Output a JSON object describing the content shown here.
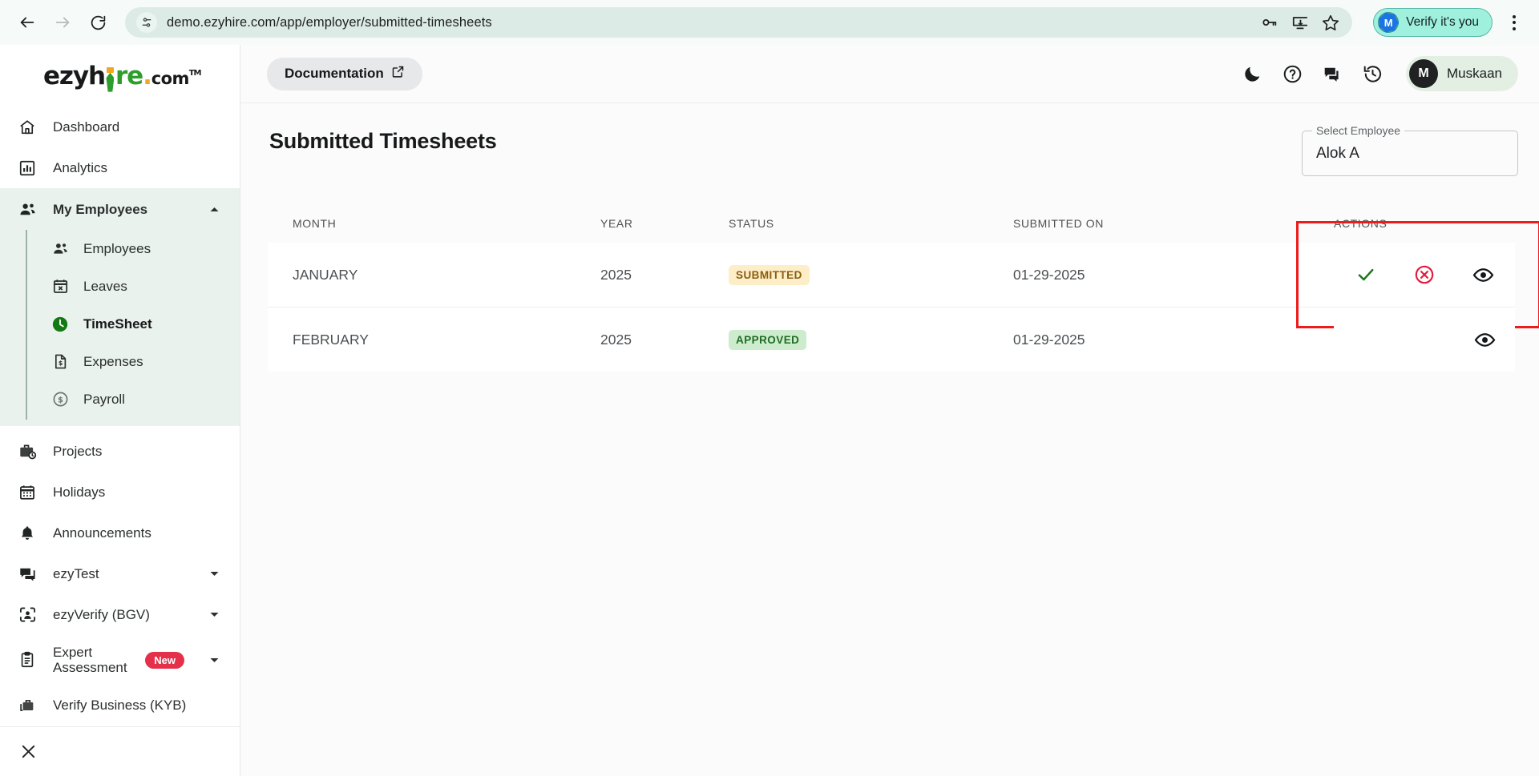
{
  "browser": {
    "url": "demo.ezyhire.com/app/employer/submitted-timesheets",
    "back_label": "Back",
    "forward_label": "Forward",
    "reload_label": "Reload",
    "site_info_icon": "tune-icon",
    "password_icon": "key-icon",
    "install_icon": "install-app-icon",
    "bookmark_icon": "star-icon",
    "verify_badge": "Verify it's you",
    "verify_avatar_initial": "M",
    "menu_icon": "kebab-menu-icon"
  },
  "sidebar": {
    "logo": {
      "text_1": "ezyh",
      "text_2": "re",
      "dot": ".",
      "com": "com",
      "tm": "TM"
    },
    "items": [
      {
        "label": "Dashboard",
        "icon": "home-icon"
      },
      {
        "label": "Analytics",
        "icon": "bar-chart-icon"
      }
    ],
    "group": {
      "label": "My Employees",
      "icon": "people-icon",
      "caret": "chevron-up-icon",
      "sub_items": [
        {
          "label": "Employees",
          "icon": "people-icon",
          "active": false
        },
        {
          "label": "Leaves",
          "icon": "calendar-x-icon",
          "active": false
        },
        {
          "label": "TimeSheet",
          "icon": "clock-icon",
          "active": true
        },
        {
          "label": "Expenses",
          "icon": "receipt-icon",
          "active": false
        },
        {
          "label": "Payroll",
          "icon": "dollar-circle-icon",
          "active": false
        }
      ]
    },
    "items_after": [
      {
        "label": "Projects",
        "icon": "briefcase-clock-icon",
        "caret": ""
      },
      {
        "label": "Holidays",
        "icon": "calendar-icon",
        "caret": ""
      },
      {
        "label": "Announcements",
        "icon": "bell-icon",
        "caret": ""
      },
      {
        "label": "ezyTest",
        "icon": "chat-icon",
        "caret": "chevron-down-icon"
      },
      {
        "label": "ezyVerify (BGV)",
        "icon": "face-scan-icon",
        "caret": "chevron-down-icon"
      }
    ],
    "expert_assessment": {
      "label_line1": "Expert",
      "label_line2": "Assessment",
      "icon": "clipboard-icon",
      "badge": "New",
      "caret": "chevron-down-icon"
    },
    "verify_business": {
      "label": "Verify Business (KYB)",
      "icon": "business-icon"
    },
    "close_label": "Close sidebar",
    "close_icon": "close-icon",
    "accent_color": "#137a13",
    "group_bg_color": "#eaf2ee"
  },
  "topbar": {
    "documentation_label": "Documentation",
    "documentation_icon": "external-link-icon",
    "icons": [
      {
        "name": "dark-mode-icon"
      },
      {
        "name": "help-icon"
      },
      {
        "name": "chat-icon"
      },
      {
        "name": "history-icon"
      }
    ],
    "user": {
      "initial": "M",
      "name": "Muskaan"
    }
  },
  "page": {
    "title": "Submitted Timesheets",
    "employee_select": {
      "label": "Select Employee",
      "value": "Alok A"
    }
  },
  "table": {
    "columns": [
      "MONTH",
      "YEAR",
      "STATUS",
      "SUBMITTED ON",
      "ACTIONS"
    ],
    "rows": [
      {
        "month": "JANUARY",
        "year": "2025",
        "status": "SUBMITTED",
        "status_type": "submitted",
        "submitted_on": "01-29-2025",
        "actions": [
          "approve-icon",
          "reject-icon",
          "view-icon"
        ]
      },
      {
        "month": "FEBRUARY",
        "year": "2025",
        "status": "APPROVED",
        "status_type": "approved",
        "submitted_on": "01-29-2025",
        "actions": [
          "view-icon"
        ]
      }
    ]
  },
  "highlight": {
    "color": "#ee1b1b",
    "target": "actions-cell-row-1"
  }
}
